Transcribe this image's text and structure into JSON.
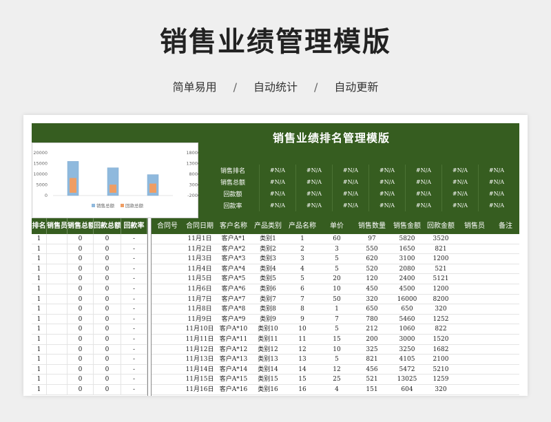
{
  "header": {
    "title": "销售业绩管理模版",
    "features": [
      "简单易用",
      "自动统计",
      "自动更新"
    ],
    "separator": "/"
  },
  "sheet": {
    "title": "销售业绩排名管理模版",
    "summary": {
      "labels": [
        "销售排名",
        "销售总额",
        "回款额",
        "回款率"
      ],
      "value": "#N/A",
      "columns": 7
    },
    "left_table": {
      "headers": [
        "排名",
        "销售员",
        "销售总额",
        "回款总额",
        "回款率"
      ],
      "rows": [
        [
          "1",
          "",
          "0",
          "0",
          "-"
        ],
        [
          "1",
          "",
          "0",
          "0",
          "-"
        ],
        [
          "1",
          "",
          "0",
          "0",
          "-"
        ],
        [
          "1",
          "",
          "0",
          "0",
          "-"
        ],
        [
          "1",
          "",
          "0",
          "0",
          "-"
        ],
        [
          "1",
          "",
          "0",
          "0",
          "-"
        ],
        [
          "1",
          "",
          "0",
          "0",
          "-"
        ],
        [
          "1",
          "",
          "0",
          "0",
          "-"
        ],
        [
          "1",
          "",
          "0",
          "0",
          "-"
        ],
        [
          "1",
          "",
          "0",
          "0",
          "-"
        ],
        [
          "1",
          "",
          "0",
          "0",
          "-"
        ],
        [
          "1",
          "",
          "0",
          "0",
          "-"
        ],
        [
          "1",
          "",
          "0",
          "0",
          "-"
        ],
        [
          "1",
          "",
          "0",
          "0",
          "-"
        ],
        [
          "1",
          "",
          "0",
          "0",
          "-"
        ],
        [
          "1",
          "",
          "0",
          "0",
          "-"
        ]
      ]
    },
    "right_table": {
      "headers": [
        "合同号",
        "合同日期",
        "客户名称",
        "产品类别",
        "产品名称",
        "单价",
        "销售数量",
        "销售金额",
        "回款金额",
        "销售员",
        "备注"
      ],
      "rows": [
        [
          "",
          "11月1日",
          "客户A*1",
          "类别1",
          "1",
          "60",
          "97",
          "5820",
          "3520",
          "",
          ""
        ],
        [
          "",
          "11月2日",
          "客户A*2",
          "类别2",
          "2",
          "3",
          "550",
          "1650",
          "821",
          "",
          ""
        ],
        [
          "",
          "11月3日",
          "客户A*3",
          "类别3",
          "3",
          "5",
          "620",
          "3100",
          "1200",
          "",
          ""
        ],
        [
          "",
          "11月4日",
          "客户A*4",
          "类别4",
          "4",
          "5",
          "520",
          "2080",
          "521",
          "",
          ""
        ],
        [
          "",
          "11月5日",
          "客户A*5",
          "类别5",
          "5",
          "20",
          "120",
          "2400",
          "5121",
          "",
          ""
        ],
        [
          "",
          "11月6日",
          "客户A*6",
          "类别6",
          "6",
          "10",
          "450",
          "4500",
          "1200",
          "",
          ""
        ],
        [
          "",
          "11月7日",
          "客户A*7",
          "类别7",
          "7",
          "50",
          "320",
          "16000",
          "8200",
          "",
          ""
        ],
        [
          "",
          "11月8日",
          "客户A*8",
          "类别8",
          "8",
          "1",
          "650",
          "650",
          "320",
          "",
          ""
        ],
        [
          "",
          "11月9日",
          "客户A*9",
          "类别9",
          "9",
          "7",
          "780",
          "5460",
          "1252",
          "",
          ""
        ],
        [
          "",
          "11月10日",
          "客户A*10",
          "类别10",
          "10",
          "5",
          "212",
          "1060",
          "822",
          "",
          ""
        ],
        [
          "",
          "11月11日",
          "客户A*11",
          "类别11",
          "11",
          "15",
          "200",
          "3000",
          "1520",
          "",
          ""
        ],
        [
          "",
          "11月12日",
          "客户A*12",
          "类别12",
          "12",
          "10",
          "325",
          "3250",
          "1682",
          "",
          ""
        ],
        [
          "",
          "11月13日",
          "客户A*13",
          "类别13",
          "13",
          "5",
          "821",
          "4105",
          "2100",
          "",
          ""
        ],
        [
          "",
          "11月14日",
          "客户A*14",
          "类别14",
          "14",
          "12",
          "456",
          "5472",
          "5210",
          "",
          ""
        ],
        [
          "",
          "11月15日",
          "客户A*15",
          "类别15",
          "15",
          "25",
          "521",
          "13025",
          "1259",
          "",
          ""
        ],
        [
          "",
          "11月16日",
          "客户A*16",
          "类别16",
          "16",
          "4",
          "151",
          "604",
          "320",
          "",
          ""
        ]
      ]
    }
  },
  "chart_data": {
    "type": "bar",
    "categories": [
      "",
      "",
      ""
    ],
    "series": [
      {
        "name": "销售总额",
        "values": [
          16000,
          13000,
          9800
        ],
        "color": "#8fb9dd"
      },
      {
        "name": "回款总额",
        "values": [
          8200,
          5100,
          5600
        ],
        "color": "#ef9d63"
      }
    ],
    "y_left": {
      "ticks": [
        "20000",
        "15000",
        "10000",
        "5000",
        "0"
      ],
      "range": [
        0,
        20000
      ]
    },
    "y_right": {
      "ticks": [
        "18000",
        "13000",
        "8000",
        "3000",
        "-2000"
      ],
      "range": [
        -2000,
        18000
      ]
    },
    "legend": "bottom"
  }
}
